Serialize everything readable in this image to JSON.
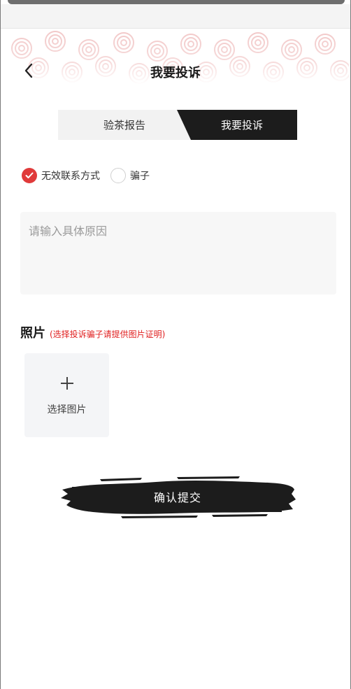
{
  "nav": {
    "title": "我要投诉",
    "back_icon": "chevron-left-icon"
  },
  "tabs": [
    {
      "label": "验茶报告",
      "active": false
    },
    {
      "label": "我要投诉",
      "active": true
    }
  ],
  "complaint_types": [
    {
      "label": "无效联系方式",
      "checked": true
    },
    {
      "label": "骗子",
      "checked": false
    }
  ],
  "reason": {
    "placeholder": "请输入具体原因",
    "value": ""
  },
  "photos": {
    "title": "照片",
    "hint": "(选择投诉骗子请提供图片证明)",
    "upload_label": "选择图片",
    "upload_icon": "plus-icon"
  },
  "submit": {
    "label": "确认提交"
  },
  "colors": {
    "accent_red": "#e03a3a",
    "hint_red": "#e02020",
    "dark": "#1c1c1c",
    "pattern_pink": "#f2c8c8"
  }
}
